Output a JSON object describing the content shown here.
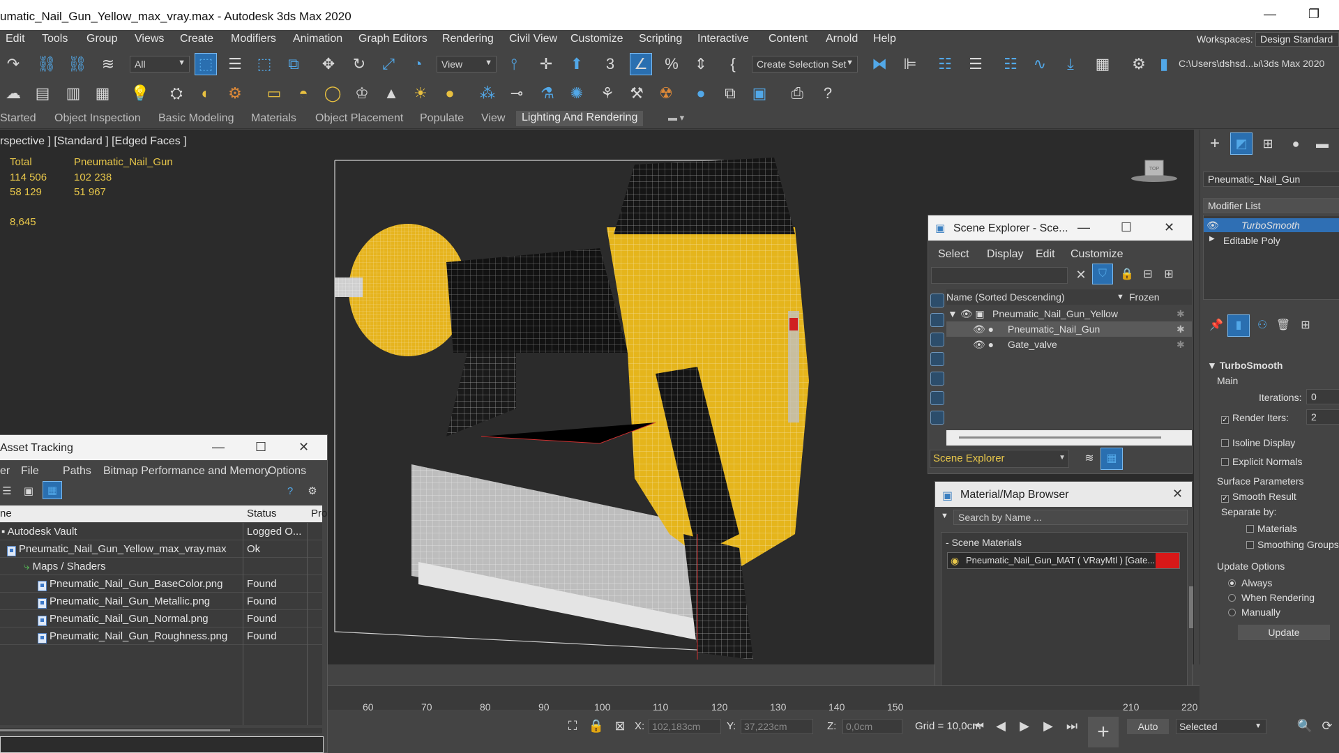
{
  "window": {
    "title": "umatic_Nail_Gun_Yellow_max_vray.max - Autodesk 3ds Max 2020",
    "minimize": "—",
    "maximize": "❐"
  },
  "menu": {
    "items": [
      "Edit",
      "Tools",
      "Group",
      "Views",
      "Create",
      "Modifiers",
      "Animation",
      "Graph Editors",
      "Rendering",
      "Civil View",
      "Customize",
      "Scripting",
      "Interactive",
      "Content",
      "Arnold",
      "Help"
    ],
    "workspaces_label": "Workspaces:",
    "workspace": "Design Standard"
  },
  "toolbar": {
    "filter": "All",
    "view": "View",
    "selection_set": "Create Selection Set",
    "project_path": "C:\\Users\\dshsd...ы\\3ds Max 2020",
    "icons": {
      "undo": "undo-icon",
      "link": "link-icon",
      "unlink": "unlink-icon",
      "bind": "bind-icon",
      "select": "select-object-icon",
      "move": "move-icon",
      "rotate": "rotate-icon",
      "scale": "scale-icon",
      "snap": "snap-3d-icon",
      "angle-snap": "angle-snap-icon",
      "percent": "percent-snap-icon",
      "spinner": "spinner-snap-icon",
      "mirror": "mirror-icon",
      "align": "align-icon",
      "render-setup": "render-setup-icon",
      "teapot": "render-icon",
      "help": "help-icon"
    }
  },
  "ribbon": {
    "tabs": [
      "Started",
      "Object Inspection",
      "Basic Modeling",
      "Materials",
      "Object Placement",
      "Populate",
      "View",
      "Lighting And Rendering"
    ],
    "active_tab": "Lighting And Rendering"
  },
  "viewport": {
    "label": "rspective ] [Standard ] [Edged Faces ]",
    "stats": {
      "total_label": "Total",
      "object_label": "Pneumatic_Nail_Gun",
      "polys_total": "114 506",
      "polys_object": "102 238",
      "verts_total": "58 129",
      "verts_object": "51 967",
      "fps": "8,645"
    },
    "viewcube_label": "TOP"
  },
  "asset_tracking": {
    "title": "Asset Tracking",
    "menu": [
      "er",
      "File",
      "Paths",
      "Bitmap Performance and Memory",
      "Options"
    ],
    "columns": [
      "ne",
      "Status",
      "Pro"
    ],
    "rows": [
      {
        "name": "Autodesk Vault",
        "status": "Logged O..."
      },
      {
        "name": "Pneumatic_Nail_Gun_Yellow_max_vray.max",
        "status": "Ok"
      },
      {
        "name": "Maps / Shaders",
        "status": ""
      },
      {
        "name": "Pneumatic_Nail_Gun_BaseColor.png",
        "status": "Found"
      },
      {
        "name": "Pneumatic_Nail_Gun_Metallic.png",
        "status": "Found"
      },
      {
        "name": "Pneumatic_Nail_Gun_Normal.png",
        "status": "Found"
      },
      {
        "name": "Pneumatic_Nail_Gun_Roughness.png",
        "status": "Found"
      }
    ]
  },
  "scene_explorer": {
    "title": "Scene Explorer - Sce...",
    "menu": [
      "Select",
      "Display",
      "Edit",
      "Customize"
    ],
    "col_name": "Name (Sorted Descending)",
    "col_frozen": "Frozen",
    "rows": [
      "Pneumatic_Nail_Gun_Yellow",
      "Pneumatic_Nail_Gun",
      "Gate_valve"
    ],
    "footer": "Scene Explorer"
  },
  "material_browser": {
    "title": "Material/Map Browser",
    "search_placeholder": "Search by Name ...",
    "group": "Scene Materials",
    "item": "Pneumatic_Nail_Gun_MAT  ( VRayMtl )  [Gate..."
  },
  "command_panel": {
    "object_name": "Pneumatic_Nail_Gun",
    "modifier_list": "Modifier List",
    "stack": [
      "TurboSmooth",
      "Editable Poly"
    ],
    "rollout": "TurboSmooth",
    "main": "Main",
    "iterations_label": "Iterations:",
    "iterations": "0",
    "render_iters_label": "Render Iters:",
    "render_iters": "2",
    "isoline": "Isoline Display",
    "explicit_normals": "Explicit Normals",
    "surface_params": "Surface Parameters",
    "smooth_result": "Smooth Result",
    "separate_by": "Separate by:",
    "materials": "Materials",
    "smoothing_groups": "Smoothing Groups",
    "update_options": "Update Options",
    "always": "Always",
    "when_rendering": "When Rendering",
    "manually": "Manually",
    "update_button": "Update"
  },
  "timeline": {
    "ticks": [
      "60",
      "70",
      "80",
      "90",
      "100",
      "110",
      "120",
      "130",
      "140",
      "150",
      "210",
      "220"
    ]
  },
  "status": {
    "x_label": "X:",
    "x_value": "102,183cm",
    "y_label": "Y:",
    "y_value": "37,223cm",
    "z_label": "Z:",
    "z_value": "0,0cm",
    "grid": "Grid = 10,0cm",
    "auto": "Auto",
    "selected": "Selected"
  },
  "colors": {
    "accent": "#2a6fb0",
    "stats": "#e8c74a",
    "model_yellow": "#e5b51c",
    "selection": "#6aa6e0"
  }
}
